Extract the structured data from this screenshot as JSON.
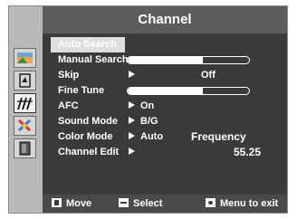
{
  "title": "Channel",
  "menu": {
    "auto_search": "Auto Search",
    "manual_search": "Manual Search",
    "skip": "Skip",
    "skip_value": "Off",
    "fine_tune": "Fine Tune",
    "afc": "AFC",
    "afc_value": "On",
    "sound_mode": "Sound Mode",
    "sound_mode_value": "B/G",
    "color_mode": "Color Mode",
    "color_mode_value": "Auto",
    "frequency_label": "Frequency",
    "channel_edit": "Channel Edit",
    "frequency_value": "55.25",
    "manual_search_level": 0.62,
    "fine_tune_level": 0.62
  },
  "footer": {
    "move": "Move",
    "select": "Select",
    "exit": "Menu to exit"
  },
  "sidebar_icons": [
    "picture-icon",
    "sound-icon",
    "channel-icon",
    "setup-icon",
    "input-icon"
  ],
  "colors": {
    "panel": "#3a3a3a",
    "title_bar": "#5d5d5d",
    "sidebar": "#b9b9b9",
    "highlight": "#dedede"
  }
}
